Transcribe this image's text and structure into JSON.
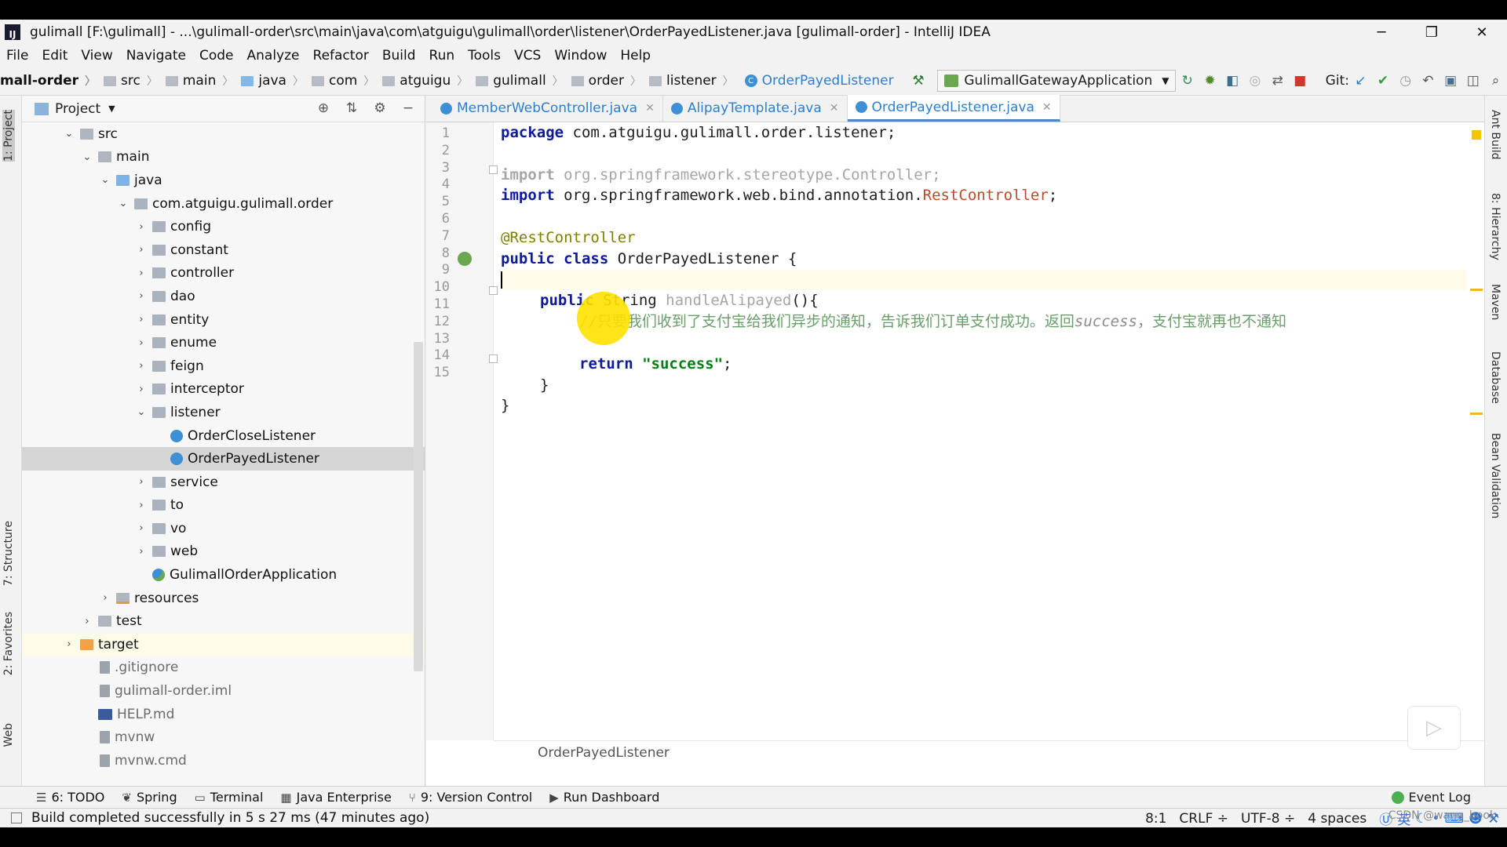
{
  "window": {
    "title": "gulimall [F:\\gulimall] - ...\\gulimall-order\\src\\main\\java\\com\\atguigu\\gulimall\\order\\listener\\OrderPayedListener.java [gulimall-order] - IntelliJ IDEA",
    "minimize": "─",
    "restore": "❐",
    "close": "✕"
  },
  "menu": [
    "File",
    "Edit",
    "View",
    "Navigate",
    "Code",
    "Analyze",
    "Refactor",
    "Build",
    "Run",
    "Tools",
    "VCS",
    "Window",
    "Help"
  ],
  "navbar": {
    "crumbs": [
      "mall-order",
      "src",
      "main",
      "java",
      "com",
      "atguigu",
      "gulimall",
      "order",
      "listener"
    ],
    "current_class": "OrderPayedListener",
    "run_config": "GulimallGatewayApplication",
    "git_label": "Git:"
  },
  "project_panel": {
    "title": "Project",
    "tree": [
      {
        "label": "src",
        "depth": 2,
        "arrow": "⌄",
        "icon": "folder"
      },
      {
        "label": "main",
        "depth": 3,
        "arrow": "⌄",
        "icon": "folder"
      },
      {
        "label": "java",
        "depth": 4,
        "arrow": "⌄",
        "icon": "blue"
      },
      {
        "label": "com.atguigu.gulimall.order",
        "depth": 5,
        "arrow": "⌄",
        "icon": "pkg"
      },
      {
        "label": "config",
        "depth": 6,
        "arrow": "›",
        "icon": "pkg"
      },
      {
        "label": "constant",
        "depth": 6,
        "arrow": "›",
        "icon": "pkg"
      },
      {
        "label": "controller",
        "depth": 6,
        "arrow": "›",
        "icon": "pkg"
      },
      {
        "label": "dao",
        "depth": 6,
        "arrow": "›",
        "icon": "pkg"
      },
      {
        "label": "entity",
        "depth": 6,
        "arrow": "›",
        "icon": "pkg"
      },
      {
        "label": "enume",
        "depth": 6,
        "arrow": "›",
        "icon": "pkg"
      },
      {
        "label": "feign",
        "depth": 6,
        "arrow": "›",
        "icon": "pkg"
      },
      {
        "label": "interceptor",
        "depth": 6,
        "arrow": "›",
        "icon": "pkg"
      },
      {
        "label": "listener",
        "depth": 6,
        "arrow": "⌄",
        "icon": "pkg"
      },
      {
        "label": "OrderCloseListener",
        "depth": 7,
        "arrow": "",
        "icon": "cls"
      },
      {
        "label": "OrderPayedListener",
        "depth": 7,
        "arrow": "",
        "icon": "cls",
        "selected": true
      },
      {
        "label": "service",
        "depth": 6,
        "arrow": "›",
        "icon": "pkg"
      },
      {
        "label": "to",
        "depth": 6,
        "arrow": "›",
        "icon": "pkg"
      },
      {
        "label": "vo",
        "depth": 6,
        "arrow": "›",
        "icon": "pkg"
      },
      {
        "label": "web",
        "depth": 6,
        "arrow": "›",
        "icon": "pkg"
      },
      {
        "label": "GulimallOrderApplication",
        "depth": 6,
        "arrow": "",
        "icon": "app"
      },
      {
        "label": "resources",
        "depth": 4,
        "arrow": "›",
        "icon": "res"
      },
      {
        "label": "test",
        "depth": 3,
        "arrow": "›",
        "icon": "folder"
      },
      {
        "label": "target",
        "depth": 2,
        "arrow": "›",
        "icon": "orange",
        "highlight": true
      },
      {
        "label": ".gitignore",
        "depth": 3,
        "arrow": "",
        "icon": "file"
      },
      {
        "label": "gulimall-order.iml",
        "depth": 3,
        "arrow": "",
        "icon": "file"
      },
      {
        "label": "HELP.md",
        "depth": 3,
        "arrow": "",
        "icon": "md"
      },
      {
        "label": "mvnw",
        "depth": 3,
        "arrow": "",
        "icon": "file"
      },
      {
        "label": "mvnw.cmd",
        "depth": 3,
        "arrow": "",
        "icon": "file"
      }
    ]
  },
  "editor": {
    "tabs": [
      {
        "label": "MemberWebController.java",
        "active": false
      },
      {
        "label": "AlipayTemplate.java",
        "active": false
      },
      {
        "label": "OrderPayedListener.java",
        "active": true
      }
    ],
    "line_numbers": [
      "1",
      "2",
      "3",
      "4",
      "5",
      "6",
      "7",
      "8",
      "9",
      "10",
      "11",
      "12",
      "13",
      "14",
      "15"
    ],
    "code": {
      "l1_kw": "package",
      "l1_rest": " com.atguigu.gulimall.order.listener;",
      "l3_kw": "import",
      "l3_rest": " org.springframework.stereotype.Controller;",
      "l4_kw": "import",
      "l4_rest": " org.springframework.web.bind.annotation.",
      "l4_cls": "RestController",
      "l4_end": ";",
      "l6_ann": "@RestController",
      "l7_kw": "public class",
      "l7_rest": " OrderPayedListener {",
      "l9_kw": "public",
      "l9_type": " String ",
      "l9_method": "handleAlipayed",
      "l9_end": "(){",
      "l10_cmt": "//只要我们收到了支付宝给我们异步的通知，告诉我们订单支付成功。返回",
      "l10_word": "success",
      "l10_cmt2": "，支付宝就再也不通知",
      "l12_kw": "return",
      "l12_str": " \"success\"",
      "l12_end": ";",
      "l13": "}",
      "l14": "}"
    },
    "breadcrumb": "OrderPayedListener"
  },
  "left_tabs": [
    "1: Project",
    "7: Structure",
    "2: Favorites",
    "Web"
  ],
  "right_tabs": [
    "Ant Build",
    "8: Hierarchy",
    "Maven",
    "Database",
    "Bean Validation"
  ],
  "toolwindows": [
    {
      "label": "6: TODO",
      "icon": "☰"
    },
    {
      "label": "Spring",
      "icon": "❦"
    },
    {
      "label": "Terminal",
      "icon": "▭"
    },
    {
      "label": "Java Enterprise",
      "icon": "▦"
    },
    {
      "label": "9: Version Control",
      "icon": "⑂"
    },
    {
      "label": "Run Dashboard",
      "icon": "▶"
    }
  ],
  "event_log": "Event Log",
  "status": {
    "message": "Build completed successfully in 5 s 27 ms (47 minutes ago)",
    "position": "8:1",
    "line_sep": "CRLF ÷",
    "encoding": "UTF-8 ÷",
    "indent": "4 spaces",
    "ime": "英"
  },
  "watermark": "CSDN @wang_book"
}
